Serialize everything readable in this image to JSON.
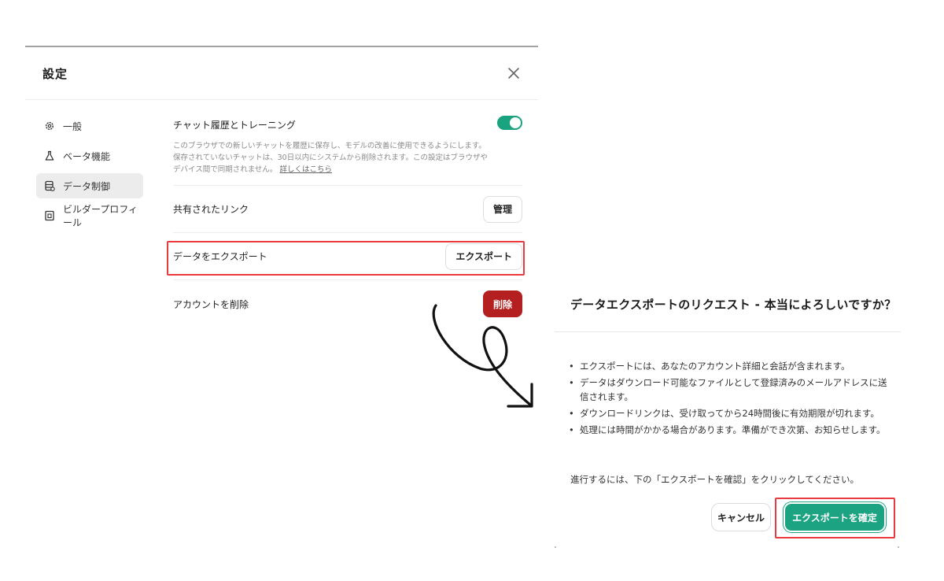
{
  "settings": {
    "title": "設定",
    "nav": [
      {
        "label": "一般",
        "icon": "gear-icon"
      },
      {
        "label": "ベータ機能",
        "icon": "flask-icon"
      },
      {
        "label": "データ制御",
        "icon": "database-icon"
      },
      {
        "label": "ビルダープロフィール",
        "icon": "profile-card-icon"
      }
    ],
    "active_nav": "データ制御",
    "chat_history": {
      "title": "チャット履歴とトレーニング",
      "toggle_on": true,
      "description": "このブラウザでの新しいチャットを履歴に保存し、モデルの改善に使用できるようにします。保存されていないチャットは、30日以内にシステムから削除されます。この設定はブラウザやデバイス間で同期されません。",
      "learn_more": "詳しくはこちら"
    },
    "shared_links": {
      "label": "共有されたリンク",
      "button": "管理"
    },
    "export": {
      "label": "データをエクスポート",
      "button": "エクスポート"
    },
    "delete": {
      "label": "アカウントを削除",
      "button": "削除"
    }
  },
  "dialog": {
    "title": "データエクスポートのリクエスト - 本当によろしいですか？",
    "bullets": [
      "エクスポートには、あなたのアカウント詳細と会話が含まれます。",
      "データはダウンロード可能なファイルとして登録済みのメールアドレスに送信されます。",
      "ダウンロードリンクは、受け取ってから24時間後に有効期限が切れます。",
      "処理には時間がかかる場合があります。準備ができ次第、お知らせします。"
    ],
    "instruction": "進行するには、下の「エクスポートを確認」をクリックしてください。",
    "cancel": "キャンセル",
    "confirm": "エクスポートを確定"
  },
  "colors": {
    "accent_green": "#1ba382",
    "danger_red": "#b3201f",
    "highlight_red": "#e83a3f"
  }
}
